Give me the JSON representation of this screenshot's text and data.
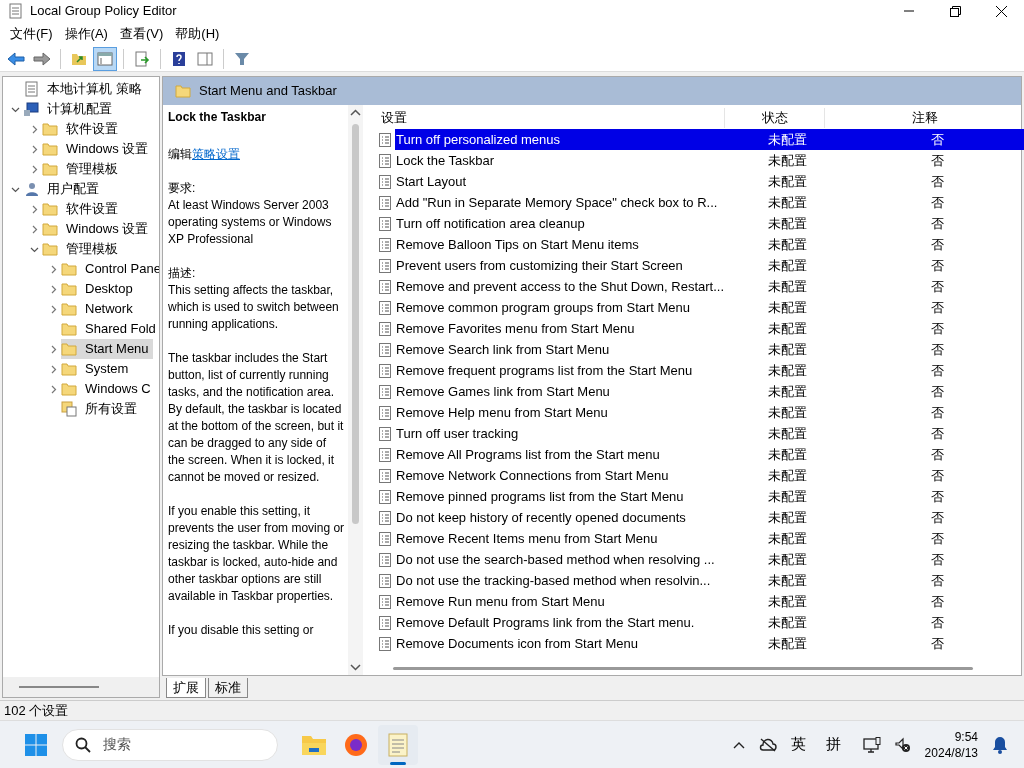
{
  "window": {
    "title": "Local Group Policy Editor"
  },
  "menu": [
    "文件(F)",
    "操作(A)",
    "查看(V)",
    "帮助(H)"
  ],
  "toolbar": [
    [
      {
        "kind": "back",
        "selected": false
      },
      {
        "kind": "forward",
        "selected": false
      }
    ],
    [
      {
        "kind": "up",
        "selected": false
      },
      {
        "kind": "tree",
        "selected": true
      }
    ],
    [
      {
        "kind": "export",
        "selected": false
      }
    ],
    [
      {
        "kind": "help",
        "selected": false
      },
      {
        "kind": "pane",
        "selected": false
      }
    ],
    [
      {
        "kind": "filter",
        "selected": false
      }
    ]
  ],
  "tree": [
    {
      "label": "本地计算机 策略",
      "kind": "policy",
      "selected": false,
      "children": [
        {
          "label": "计算机配置",
          "kind": "computer",
          "expanded": true,
          "selected": false,
          "children": [
            {
              "label": "软件设置",
              "kind": "folder",
              "expanded": false,
              "selected": false
            },
            {
              "label": "Windows 设置",
              "kind": "folder",
              "expanded": false,
              "selected": false
            },
            {
              "label": "管理模板",
              "kind": "folder",
              "expanded": false,
              "selected": false
            }
          ]
        },
        {
          "label": "用户配置",
          "kind": "user",
          "expanded": true,
          "selected": false,
          "children": [
            {
              "label": "软件设置",
              "kind": "folder",
              "expanded": false,
              "selected": false
            },
            {
              "label": "Windows 设置",
              "kind": "folder",
              "expanded": false,
              "selected": false
            },
            {
              "label": "管理模板",
              "kind": "folder",
              "expanded": true,
              "selected": false,
              "children": [
                {
                  "label": "Control Pane",
                  "kind": "folder",
                  "expanded": false,
                  "selected": false
                },
                {
                  "label": "Desktop",
                  "kind": "folder",
                  "expanded": false,
                  "selected": false
                },
                {
                  "label": "Network",
                  "kind": "folder",
                  "expanded": false,
                  "selected": false
                },
                {
                  "label": "Shared Fold",
                  "kind": "folder",
                  "selected": false
                },
                {
                  "label": "Start Menu",
                  "kind": "folder",
                  "expanded": false,
                  "selected": true
                },
                {
                  "label": "System",
                  "kind": "folder",
                  "expanded": false,
                  "selected": false
                },
                {
                  "label": "Windows C",
                  "kind": "folder",
                  "expanded": false,
                  "selected": false
                },
                {
                  "label": "所有设置",
                  "kind": "settings",
                  "selected": false
                }
              ]
            }
          ]
        }
      ]
    }
  ],
  "header": {
    "title": "Start Menu and Taskbar"
  },
  "details": {
    "title": "Lock the Taskbar",
    "edit_prefix": "编辑",
    "edit_link": "策略设置",
    "requirements_label": "要求:",
    "requirements": "At least Windows Server 2003 operating systems or Windows XP Professional",
    "description_label": "描述:",
    "paragraphs": [
      "This setting affects the taskbar, which is used to switch between running applications.",
      "The taskbar includes the Start button, list of currently running tasks, and the notification area. By default, the taskbar is located at the bottom of the screen, but it can be dragged to any side of the screen. When it is locked, it cannot be moved or resized.",
      "If you enable this setting, it prevents the user from moving or resizing the taskbar. While the taskbar is locked, auto-hide and other taskbar options are still available in Taskbar properties.",
      "If you disable this setting or"
    ]
  },
  "table": {
    "columns": [
      "设置",
      "状态",
      "注释"
    ],
    "rows": [
      {
        "name": "Turn off personalized menus",
        "state": "未配置",
        "comment": "否",
        "selected": true
      },
      {
        "name": "Lock the Taskbar",
        "state": "未配置",
        "comment": "否",
        "selected": false
      },
      {
        "name": "Start Layout",
        "state": "未配置",
        "comment": "否",
        "selected": false
      },
      {
        "name": "Add \"Run in Separate Memory Space\" check box to R...",
        "state": "未配置",
        "comment": "否",
        "selected": false
      },
      {
        "name": "Turn off notification area cleanup",
        "state": "未配置",
        "comment": "否",
        "selected": false
      },
      {
        "name": "Remove Balloon Tips on Start Menu items",
        "state": "未配置",
        "comment": "否",
        "selected": false
      },
      {
        "name": "Prevent users from customizing their Start Screen",
        "state": "未配置",
        "comment": "否",
        "selected": false
      },
      {
        "name": "Remove and prevent access to the Shut Down, Restart...",
        "state": "未配置",
        "comment": "否",
        "selected": false
      },
      {
        "name": "Remove common program groups from Start Menu",
        "state": "未配置",
        "comment": "否",
        "selected": false
      },
      {
        "name": "Remove Favorites menu from Start Menu",
        "state": "未配置",
        "comment": "否",
        "selected": false
      },
      {
        "name": "Remove Search link from Start Menu",
        "state": "未配置",
        "comment": "否",
        "selected": false
      },
      {
        "name": "Remove frequent programs list from the Start Menu",
        "state": "未配置",
        "comment": "否",
        "selected": false
      },
      {
        "name": "Remove Games link from Start Menu",
        "state": "未配置",
        "comment": "否",
        "selected": false
      },
      {
        "name": "Remove Help menu from Start Menu",
        "state": "未配置",
        "comment": "否",
        "selected": false
      },
      {
        "name": "Turn off user tracking",
        "state": "未配置",
        "comment": "否",
        "selected": false
      },
      {
        "name": "Remove All Programs list from the Start menu",
        "state": "未配置",
        "comment": "否",
        "selected": false
      },
      {
        "name": "Remove Network Connections from Start Menu",
        "state": "未配置",
        "comment": "否",
        "selected": false
      },
      {
        "name": "Remove pinned programs list from the Start Menu",
        "state": "未配置",
        "comment": "否",
        "selected": false
      },
      {
        "name": "Do not keep history of recently opened documents",
        "state": "未配置",
        "comment": "否",
        "selected": false
      },
      {
        "name": "Remove Recent Items menu from Start Menu",
        "state": "未配置",
        "comment": "否",
        "selected": false
      },
      {
        "name": "Do not use the search-based method when resolving ...",
        "state": "未配置",
        "comment": "否",
        "selected": false
      },
      {
        "name": "Do not use the tracking-based method when resolvin...",
        "state": "未配置",
        "comment": "否",
        "selected": false
      },
      {
        "name": "Remove Run menu from Start Menu",
        "state": "未配置",
        "comment": "否",
        "selected": false
      },
      {
        "name": "Remove Default Programs link from the Start menu.",
        "state": "未配置",
        "comment": "否",
        "selected": false
      },
      {
        "name": "Remove Documents icon from Start Menu",
        "state": "未配置",
        "comment": "否",
        "selected": false
      }
    ]
  },
  "tabs": [
    {
      "label": "扩展",
      "selected": true
    },
    {
      "label": "标准",
      "selected": false
    }
  ],
  "status_bar": {
    "text": "102 个设置"
  },
  "taskbar": {
    "search_placeholder": "搜索",
    "apps": [
      {
        "kind": "explorer",
        "active": false
      },
      {
        "kind": "firefox",
        "active": false
      },
      {
        "kind": "notepad",
        "active": true
      }
    ],
    "tray": {
      "lang": "英",
      "ime": "拼",
      "time": "9:54",
      "date": "2024/8/13"
    }
  }
}
